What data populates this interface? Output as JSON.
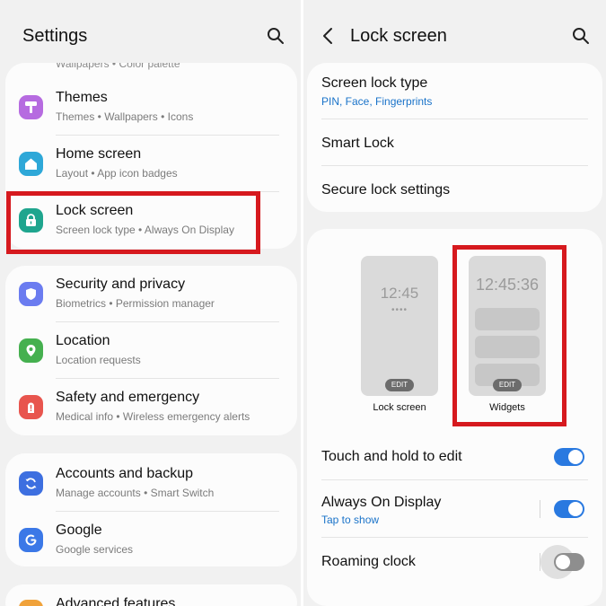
{
  "left": {
    "title": "Settings",
    "partial_row": "Wallpapers • Color palette",
    "items": [
      {
        "title": "Themes",
        "subtitle": "Themes  •  Wallpapers  •  Icons",
        "icon": "themes-icon",
        "color": "#b66be0"
      },
      {
        "title": "Home screen",
        "subtitle": "Layout  •  App icon badges",
        "icon": "home-icon",
        "color": "#2ea8d8"
      },
      {
        "title": "Lock screen",
        "subtitle": "Screen lock type  •  Always On Display",
        "icon": "lock-icon",
        "color": "#1fa58e"
      },
      {
        "title": "Security and privacy",
        "subtitle": "Biometrics  •  Permission manager",
        "icon": "shield-icon",
        "color": "#6b7cf0"
      },
      {
        "title": "Location",
        "subtitle": "Location requests",
        "icon": "location-pin-icon",
        "color": "#45b04f"
      },
      {
        "title": "Safety and emergency",
        "subtitle": "Medical info  •  Wireless emergency alerts",
        "icon": "alert-icon",
        "color": "#e8554e"
      },
      {
        "title": "Accounts and backup",
        "subtitle": "Manage accounts  •  Smart Switch",
        "icon": "sync-icon",
        "color": "#3d6fe0"
      },
      {
        "title": "Google",
        "subtitle": "Google services",
        "icon": "google-icon",
        "color": "#3b78e7"
      }
    ],
    "bottom_partial": "Advanced features"
  },
  "right": {
    "title": "Lock screen",
    "screen_lock_type": {
      "title": "Screen lock type",
      "subtitle": "PIN, Face, Fingerprints"
    },
    "smart_lock": "Smart Lock",
    "secure_lock": "Secure lock settings",
    "previews": [
      {
        "clock": "12:45",
        "dots": "••••",
        "edit": "EDIT",
        "caption": "Lock screen"
      },
      {
        "clock": "12:45:36",
        "edit": "EDIT",
        "caption": "Widgets"
      }
    ],
    "toggles": [
      {
        "title": "Touch and hold to edit",
        "state": "on"
      },
      {
        "title": "Always On Display",
        "subtitle": "Tap to show",
        "state": "on"
      },
      {
        "title": "Roaming clock",
        "state": "off"
      }
    ]
  },
  "colors": {
    "highlight": "#d6191e",
    "accent_blue": "#2979e0",
    "link_blue": "#1a73c9"
  }
}
